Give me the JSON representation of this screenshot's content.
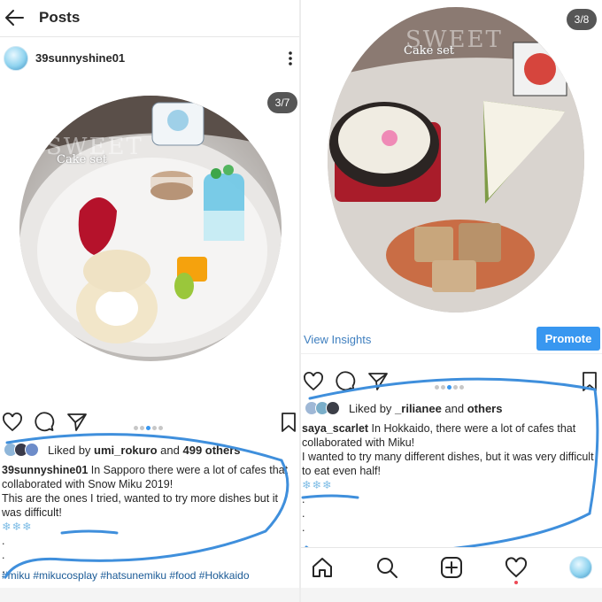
{
  "left": {
    "header": {
      "title": "Posts"
    },
    "author": {
      "username": "39sunnyshine01"
    },
    "photo": {
      "counter": "3/7",
      "watermark": "SWEET",
      "label": "Cake set"
    },
    "likes": {
      "prefix": "Liked by ",
      "user": "umi_rokuro",
      "middle": " and ",
      "others": "499 others"
    },
    "caption": {
      "username": "39sunnyshine01",
      "line1": " In Sapporo there were a lot of cafes that collaborated with Snow Miku 2019!",
      "line2": "This are the ones I tried, wanted to try more dishes but it was difficult!",
      "snowflakes": "❄❄❄",
      "dot_lines": [
        ".",
        ".",
        "."
      ]
    },
    "hashtags": "#miku #mikucosplay #hatsunemiku #food #Hokkaido",
    "carousel": {
      "count": 7,
      "active": 3
    }
  },
  "right": {
    "photo": {
      "counter": "3/8",
      "watermark": "SWEET",
      "label": "Cake set"
    },
    "insights": {
      "link": "View Insights",
      "promote": "Promote"
    },
    "likes": {
      "prefix": "Liked by ",
      "user": "_rilianee",
      "middle": " and ",
      "others": "others"
    },
    "caption": {
      "username": "saya_scarlet",
      "line1": " In Hokkaido, there were a lot of cafes that collaborated with Miku!",
      "line2": "I wanted to try many different dishes, but it was very difficult to eat even half!",
      "snowflakes": "❄❄❄",
      "dot_lines": [
        ".",
        ".",
        "."
      ]
    },
    "carousel": {
      "count": 8,
      "active": 3
    },
    "nav": {
      "items": [
        "home-icon",
        "search-icon",
        "add-post-icon",
        "activity-heart-icon",
        "profile-avatar"
      ]
    }
  },
  "colors": {
    "accent": "#3897f0",
    "scribble": "#3f8fdc",
    "hashtag": "#1a5a96",
    "link": "#3f7fbf"
  }
}
